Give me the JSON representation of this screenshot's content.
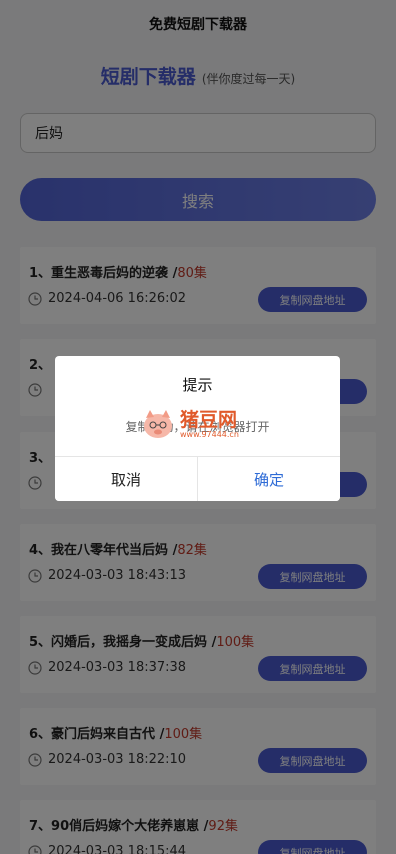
{
  "app": {
    "title": "免费短剧下载器",
    "brand_title": "短剧下载器",
    "brand_subtitle": "(伴你度过每一天)"
  },
  "search": {
    "value": "后妈",
    "button_label": "搜索"
  },
  "results": [
    {
      "index": "1、",
      "name": "重生恶毒后妈的逆袭",
      "sep": " /",
      "episodes": "80集",
      "time": "2024-04-06 16:26:02",
      "button": "复制网盘地址"
    },
    {
      "index": "2、",
      "name": "",
      "sep": "",
      "episodes": "",
      "time": "",
      "button": ""
    },
    {
      "index": "3、",
      "name": "",
      "sep": "",
      "episodes": "",
      "time": "",
      "button": ""
    },
    {
      "index": "4、",
      "name": "我在八零年代当后妈",
      "sep": " /",
      "episodes": "82集",
      "time": "2024-03-03 18:43:13",
      "button": "复制网盘地址"
    },
    {
      "index": "5、",
      "name": "闪婚后，我摇身一变成后妈",
      "sep": " /",
      "episodes": "100集",
      "time": "2024-03-03 18:37:38",
      "button": "复制网盘地址"
    },
    {
      "index": "6、",
      "name": "豪门后妈来自古代",
      "sep": " /",
      "episodes": "100集",
      "time": "2024-03-03 18:22:10",
      "button": "复制网盘地址"
    },
    {
      "index": "7、",
      "name": "90俏后妈嫁个大佬养崽崽",
      "sep": " /",
      "episodes": "92集",
      "time": "2024-03-03 18:15:44",
      "button": "复制网盘地址"
    }
  ],
  "dialog": {
    "title": "提示",
    "message": "复制成功，请在浏览器打开",
    "cancel_label": "取消",
    "confirm_label": "确定"
  },
  "watermark": {
    "main": "猪豆网",
    "sub": "www.97444.cn"
  },
  "colors": {
    "accent": "#4a5bd0",
    "episodes": "#c0392b",
    "confirm": "#2e6bd6",
    "watermark": "#e05a2b"
  },
  "icons": {
    "clock": "clock-icon",
    "watermark_logo": "pig-logo-icon"
  }
}
